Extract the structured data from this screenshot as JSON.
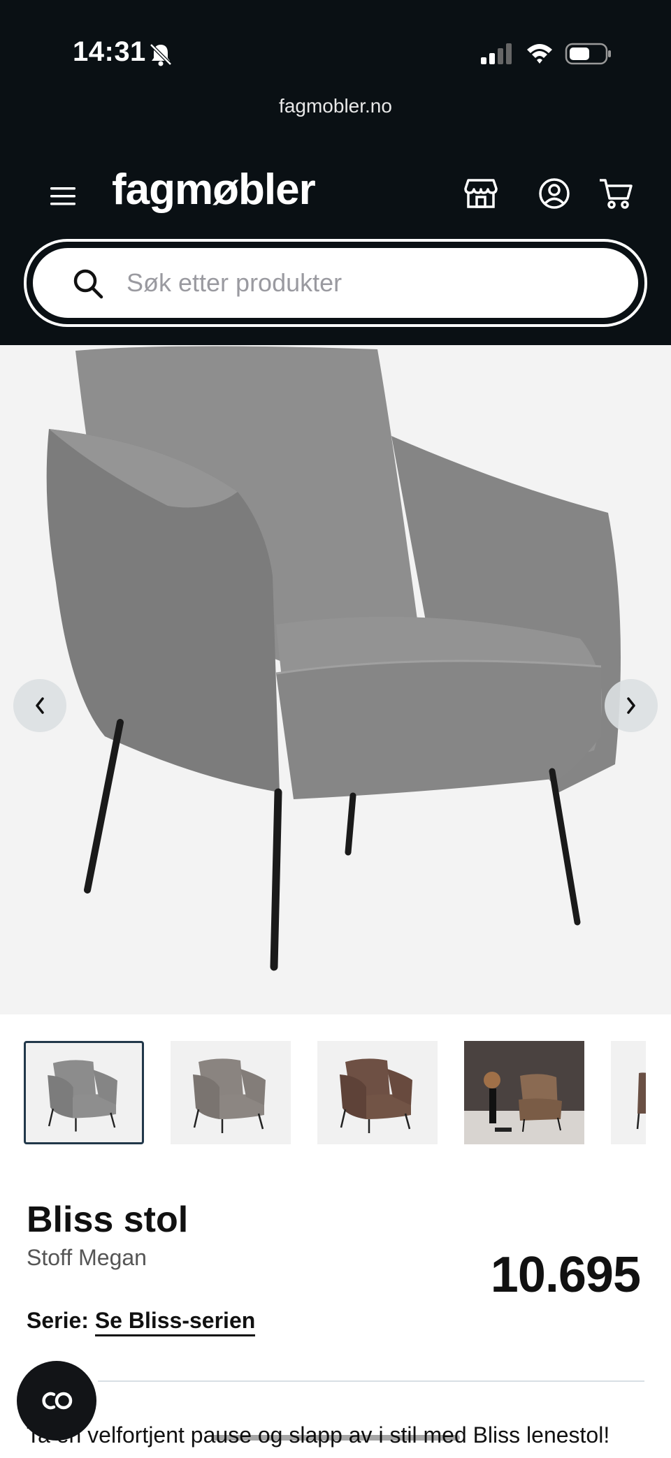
{
  "status_bar": {
    "time": "14:31",
    "icons": [
      "bell-slash-icon",
      "signal-icon",
      "wifi-icon",
      "battery-icon"
    ]
  },
  "browser": {
    "url": "fagmobler.no"
  },
  "header": {
    "logo": "fagmøbler",
    "icons": [
      "menu-icon",
      "store-icon",
      "account-icon",
      "cart-icon"
    ]
  },
  "search": {
    "placeholder": "Søk etter produkter",
    "value": ""
  },
  "gallery": {
    "prev_icon": "chevron-left-icon",
    "next_icon": "chevron-right-icon",
    "thumbnails": [
      {
        "name": "grey chair",
        "active": true
      },
      {
        "name": "taupe chair",
        "active": false
      },
      {
        "name": "brown chair",
        "active": false
      },
      {
        "name": "brown chair room",
        "active": false
      },
      {
        "name": "partial",
        "active": false
      }
    ]
  },
  "product": {
    "title": "Bliss stol",
    "subtitle": "Stoff Megan",
    "price": "10.695",
    "series_label": "Serie:",
    "series_link": "Se Bliss-serien",
    "description": "Ta en velfortjent pause og slapp av i stil med Bliss lenestol!"
  },
  "colors": {
    "header_bg": "#0a1014",
    "accent_border": "#22384a",
    "chair_grey": "#8a8a8a",
    "chair_brown": "#6b4a3a"
  }
}
